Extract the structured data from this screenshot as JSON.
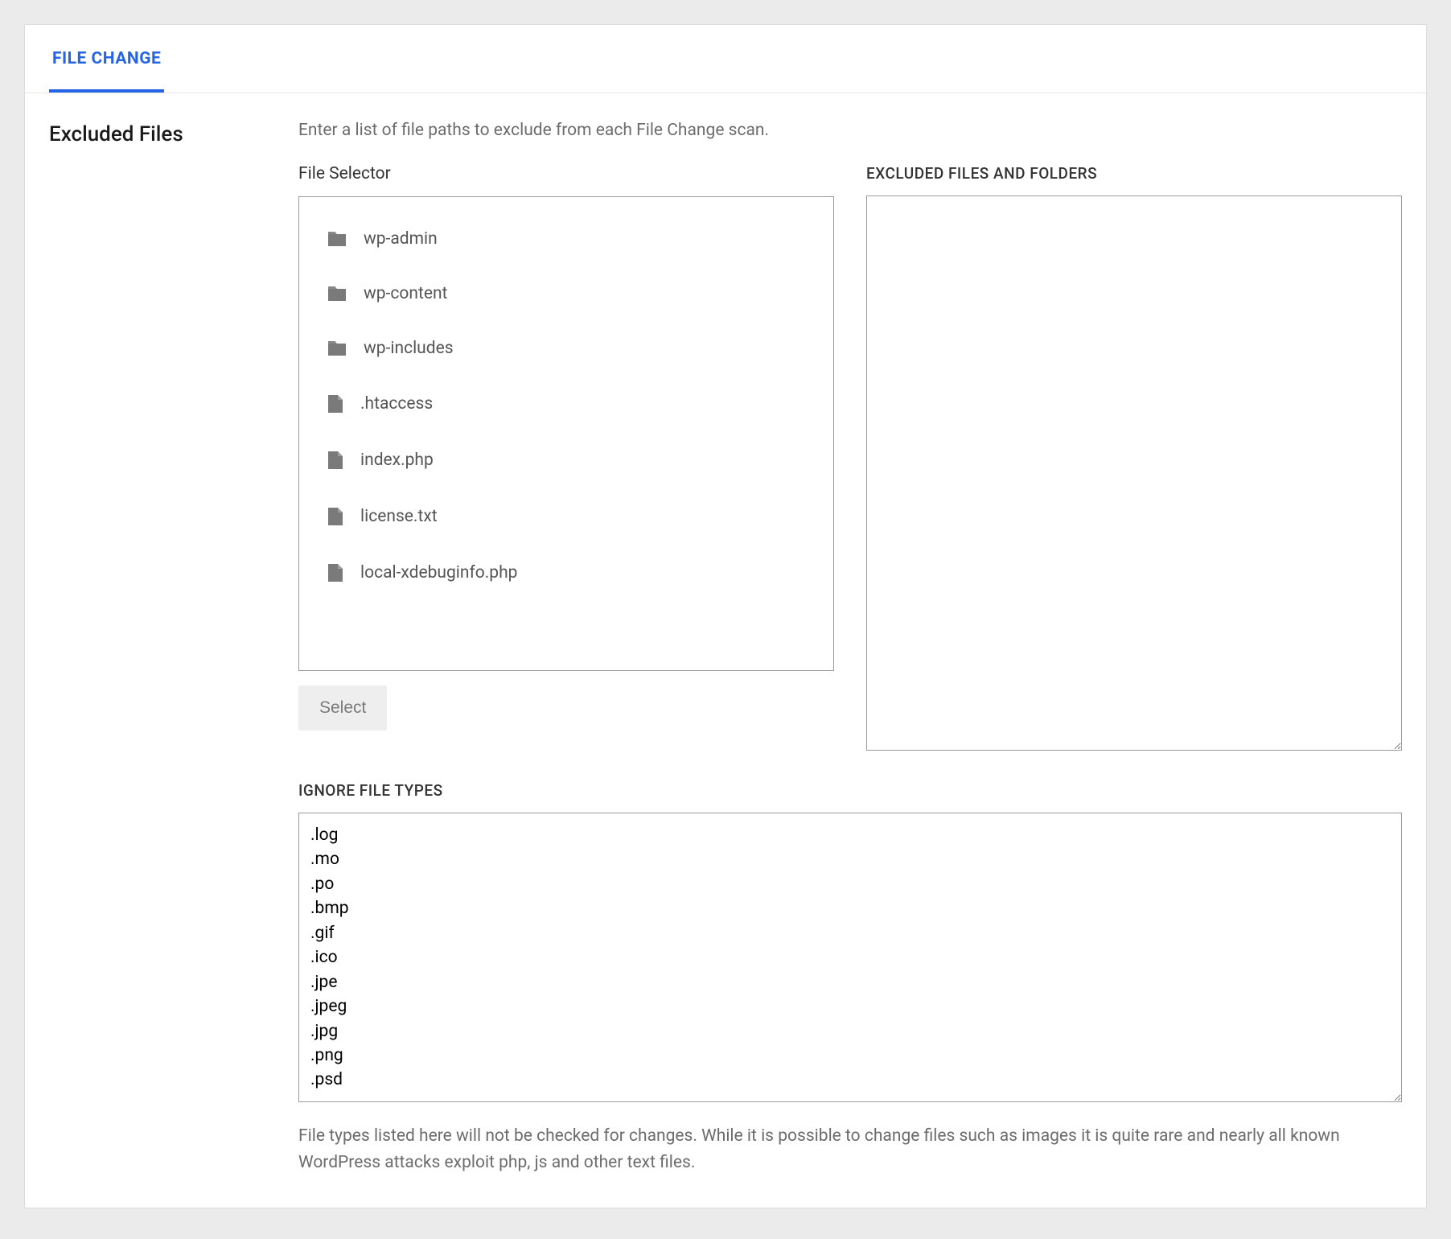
{
  "tab": {
    "label": "FILE CHANGE"
  },
  "section": {
    "title": "Excluded Files",
    "intro": "Enter a list of file paths to exclude from each File Change scan."
  },
  "file_selector": {
    "label": "File Selector",
    "items": [
      {
        "name": "wp-admin",
        "kind": "folder"
      },
      {
        "name": "wp-content",
        "kind": "folder"
      },
      {
        "name": "wp-includes",
        "kind": "folder"
      },
      {
        "name": ".htaccess",
        "kind": "file"
      },
      {
        "name": "index.php",
        "kind": "file"
      },
      {
        "name": "license.txt",
        "kind": "file"
      },
      {
        "name": "local-xdebuginfo.php",
        "kind": "file"
      }
    ],
    "select_button": "Select"
  },
  "excluded": {
    "label": "EXCLUDED FILES AND FOLDERS",
    "value": ""
  },
  "ignore": {
    "label": "IGNORE FILE TYPES",
    "value": ".log\n.mo\n.po\n.bmp\n.gif\n.ico\n.jpe\n.jpeg\n.jpg\n.png\n.psd",
    "help": "File types listed here will not be checked for changes. While it is possible to change files such as images it is quite rare and nearly all known WordPress attacks exploit php, js and other text files."
  },
  "icons": {
    "folder": "folder-icon",
    "file": "file-icon"
  }
}
